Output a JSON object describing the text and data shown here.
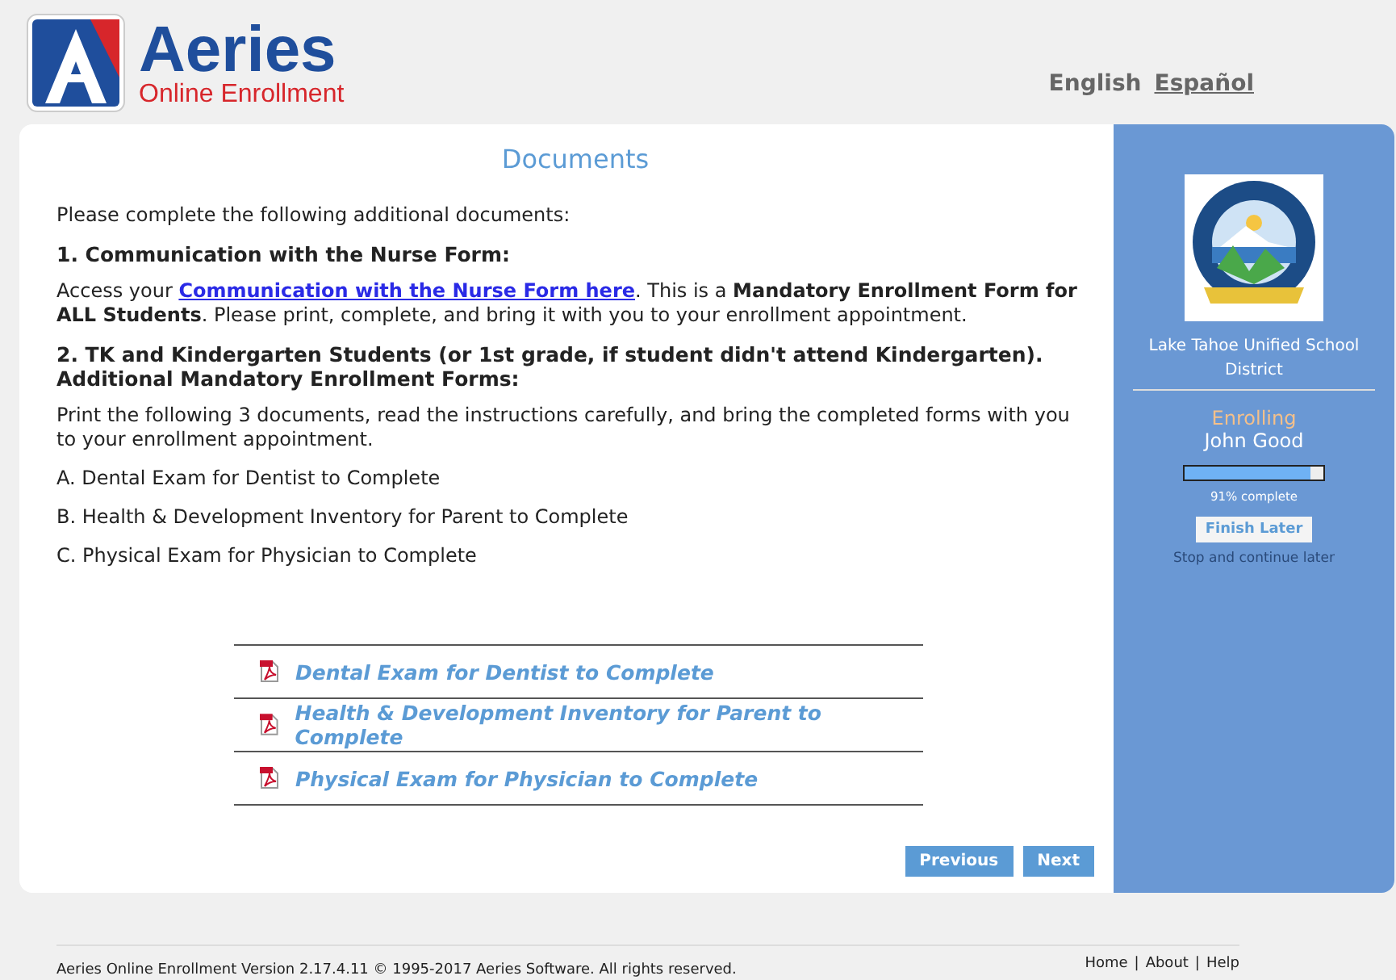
{
  "header": {
    "brand": "Aeries",
    "subtitle": "Online Enrollment",
    "languages": [
      {
        "label": "English",
        "selected": true
      },
      {
        "label": "Español",
        "selected": false
      }
    ]
  },
  "main": {
    "title": "Documents",
    "intro": "Please complete the following additional documents:",
    "sections": [
      {
        "heading": "1. Communication with the Nurse Form:",
        "text_before": "Access your ",
        "link": "Communication with the Nurse Form here",
        "text_after": ".  This is a **Mandatory Enrollment Form for ALL Students**.  Please print, complete, and bring it with you to your enrollment appointment."
      },
      {
        "heading": "2. TK and Kindergarten Students (or 1st grade, if student didn't attend Kindergarten). Additional Mandatory Enrollment Forms:",
        "text_before": "Print the following 3 documents, read the instructions carefully, and bring the completed forms with you to your enrollment appointment."
      }
    ],
    "list": [
      "A. Dental Exam for Dentist to Complete",
      "B. Health & Development Inventory for Parent to Complete",
      "C. Physical Exam for Physician to Complete"
    ],
    "documents": [
      "Dental Exam for Dentist to Complete",
      "Health & Development Inventory for Parent to Complete",
      "Physical Exam for Physician to Complete"
    ],
    "buttons": [
      "Previous",
      "Next"
    ]
  },
  "sidebar": {
    "district": "Lake Tahoe Unified School District",
    "status": "Enrolling",
    "student": "John Good",
    "progress": {
      "level": 0.91,
      "label": "91% complete"
    },
    "finish_button": "Finish Later",
    "finish_hint": "Stop and continue later"
  },
  "footer": {
    "copyright": "Aeries Online Enrollment Version 2.17.4.11 © 1995-2017 Aeries Software. All rights reserved.",
    "links": [
      "Home",
      "About",
      "Help"
    ],
    "separator": "|"
  }
}
